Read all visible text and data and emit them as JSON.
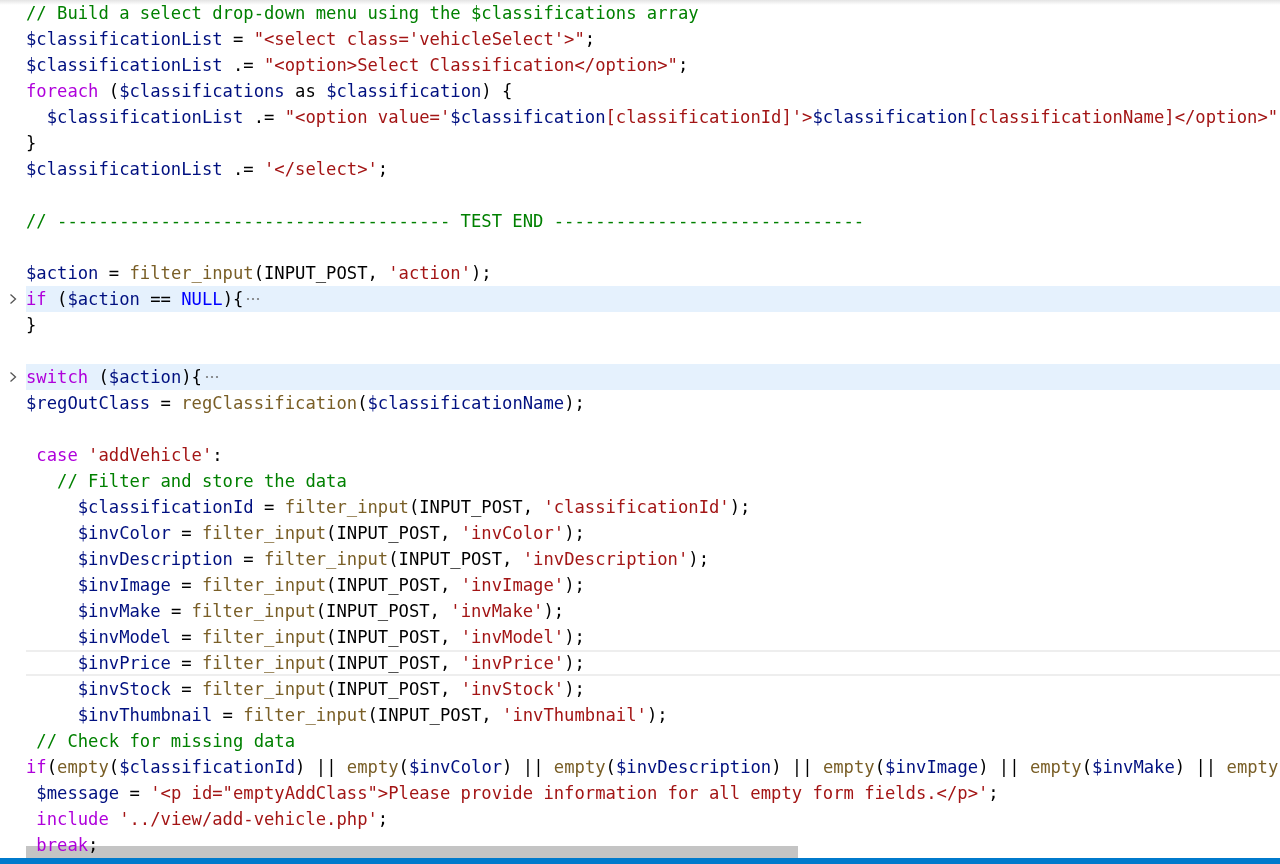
{
  "editor": {
    "lines": [
      {
        "kind": "code",
        "folded": false,
        "current": false,
        "tokens": [
          {
            "kind": "comment",
            "t": "// Build a select drop-down menu using the $classifications array"
          }
        ]
      },
      {
        "kind": "code",
        "folded": false,
        "current": false,
        "tokens": [
          {
            "kind": "var",
            "t": "$classificationList"
          },
          {
            "kind": "plain",
            "t": " = "
          },
          {
            "kind": "string",
            "t": "\"<select class='vehicleSelect'>\""
          },
          {
            "kind": "plain",
            "t": ";"
          }
        ]
      },
      {
        "kind": "code",
        "folded": false,
        "current": false,
        "tokens": [
          {
            "kind": "var",
            "t": "$classificationList"
          },
          {
            "kind": "plain",
            "t": " .= "
          },
          {
            "kind": "string",
            "t": "\"<option>Select Classification</option>\""
          },
          {
            "kind": "plain",
            "t": ";"
          }
        ]
      },
      {
        "kind": "code",
        "folded": false,
        "current": false,
        "tokens": [
          {
            "kind": "keyword",
            "t": "foreach"
          },
          {
            "kind": "plain",
            "t": " ("
          },
          {
            "kind": "var",
            "t": "$classifications"
          },
          {
            "kind": "plain",
            "t": " as "
          },
          {
            "kind": "var",
            "t": "$classification"
          },
          {
            "kind": "plain",
            "t": ") {"
          }
        ]
      },
      {
        "kind": "code",
        "folded": false,
        "current": false,
        "tokens": [
          {
            "kind": "var",
            "t": "  $classificationList"
          },
          {
            "kind": "plain",
            "t": " .= "
          },
          {
            "kind": "string",
            "t": "\"<option value='"
          },
          {
            "kind": "var",
            "t": "$classification"
          },
          {
            "kind": "string",
            "t": "[classificationId]'>"
          },
          {
            "kind": "var",
            "t": "$classification"
          },
          {
            "kind": "string",
            "t": "[classificationName]</option>\""
          }
        ]
      },
      {
        "kind": "code",
        "folded": false,
        "current": false,
        "tokens": [
          {
            "kind": "plain",
            "t": "}"
          }
        ]
      },
      {
        "kind": "code",
        "folded": false,
        "current": false,
        "tokens": [
          {
            "kind": "var",
            "t": "$classificationList"
          },
          {
            "kind": "plain",
            "t": " .= "
          },
          {
            "kind": "string",
            "t": "'</select>'"
          },
          {
            "kind": "plain",
            "t": ";"
          }
        ]
      },
      {
        "kind": "blank"
      },
      {
        "kind": "code",
        "folded": false,
        "current": false,
        "tokens": [
          {
            "kind": "comment",
            "t": "// -------------------------------------- TEST END ------------------------------"
          }
        ]
      },
      {
        "kind": "blank"
      },
      {
        "kind": "code",
        "folded": false,
        "current": false,
        "tokens": [
          {
            "kind": "var",
            "t": "$action"
          },
          {
            "kind": "plain",
            "t": " = "
          },
          {
            "kind": "func",
            "t": "filter_input"
          },
          {
            "kind": "plain",
            "t": "(INPUT_POST, "
          },
          {
            "kind": "string",
            "t": "'action'"
          },
          {
            "kind": "plain",
            "t": ");"
          }
        ]
      },
      {
        "kind": "code",
        "folded": true,
        "current": false,
        "tokens": [
          {
            "kind": "keyword",
            "t": "if"
          },
          {
            "kind": "plain",
            "t": " ("
          },
          {
            "kind": "var",
            "t": "$action"
          },
          {
            "kind": "plain",
            "t": " == "
          },
          {
            "kind": "const",
            "t": "NULL"
          },
          {
            "kind": "plain",
            "t": "){"
          }
        ]
      },
      {
        "kind": "code",
        "folded": false,
        "current": false,
        "tokens": [
          {
            "kind": "plain",
            "t": "}"
          }
        ]
      },
      {
        "kind": "blank"
      },
      {
        "kind": "code",
        "folded": true,
        "current": false,
        "tokens": [
          {
            "kind": "keyword",
            "t": "switch"
          },
          {
            "kind": "plain",
            "t": " ("
          },
          {
            "kind": "var",
            "t": "$action"
          },
          {
            "kind": "plain",
            "t": "){"
          }
        ]
      },
      {
        "kind": "code",
        "folded": false,
        "current": false,
        "tokens": [
          {
            "kind": "var",
            "t": "$regOutClass"
          },
          {
            "kind": "plain",
            "t": " = "
          },
          {
            "kind": "func",
            "t": "regClassification"
          },
          {
            "kind": "plain",
            "t": "("
          },
          {
            "kind": "var",
            "t": "$classificationName"
          },
          {
            "kind": "plain",
            "t": ");"
          }
        ]
      },
      {
        "kind": "blank"
      },
      {
        "kind": "code",
        "folded": false,
        "current": false,
        "tokens": [
          {
            "kind": "keyword",
            "t": " case"
          },
          {
            "kind": "string",
            "t": " 'addVehicle'"
          },
          {
            "kind": "plain",
            "t": ":"
          }
        ]
      },
      {
        "kind": "code",
        "folded": false,
        "current": false,
        "tokens": [
          {
            "kind": "comment",
            "t": "   // Filter and store the data"
          }
        ]
      },
      {
        "kind": "code",
        "folded": false,
        "current": false,
        "tokens": [
          {
            "kind": "var",
            "t": "     $classificationId"
          },
          {
            "kind": "plain",
            "t": " = "
          },
          {
            "kind": "func",
            "t": "filter_input"
          },
          {
            "kind": "plain",
            "t": "(INPUT_POST, "
          },
          {
            "kind": "string",
            "t": "'classificationId'"
          },
          {
            "kind": "plain",
            "t": ");"
          }
        ]
      },
      {
        "kind": "code",
        "folded": false,
        "current": false,
        "tokens": [
          {
            "kind": "var",
            "t": "     $invColor"
          },
          {
            "kind": "plain",
            "t": " = "
          },
          {
            "kind": "func",
            "t": "filter_input"
          },
          {
            "kind": "plain",
            "t": "(INPUT_POST, "
          },
          {
            "kind": "string",
            "t": "'invColor'"
          },
          {
            "kind": "plain",
            "t": ");"
          }
        ]
      },
      {
        "kind": "code",
        "folded": false,
        "current": false,
        "tokens": [
          {
            "kind": "var",
            "t": "     $invDescription"
          },
          {
            "kind": "plain",
            "t": " = "
          },
          {
            "kind": "func",
            "t": "filter_input"
          },
          {
            "kind": "plain",
            "t": "(INPUT_POST, "
          },
          {
            "kind": "string",
            "t": "'invDescription'"
          },
          {
            "kind": "plain",
            "t": ");"
          }
        ]
      },
      {
        "kind": "code",
        "folded": false,
        "current": false,
        "tokens": [
          {
            "kind": "var",
            "t": "     $invImage"
          },
          {
            "kind": "plain",
            "t": " = "
          },
          {
            "kind": "func",
            "t": "filter_input"
          },
          {
            "kind": "plain",
            "t": "(INPUT_POST, "
          },
          {
            "kind": "string",
            "t": "'invImage'"
          },
          {
            "kind": "plain",
            "t": ");"
          }
        ]
      },
      {
        "kind": "code",
        "folded": false,
        "current": false,
        "tokens": [
          {
            "kind": "var",
            "t": "     $invMake"
          },
          {
            "kind": "plain",
            "t": " = "
          },
          {
            "kind": "func",
            "t": "filter_input"
          },
          {
            "kind": "plain",
            "t": "(INPUT_POST, "
          },
          {
            "kind": "string",
            "t": "'invMake'"
          },
          {
            "kind": "plain",
            "t": ");"
          }
        ]
      },
      {
        "kind": "code",
        "folded": false,
        "current": false,
        "tokens": [
          {
            "kind": "var",
            "t": "     $invModel"
          },
          {
            "kind": "plain",
            "t": " = "
          },
          {
            "kind": "func",
            "t": "filter_input"
          },
          {
            "kind": "plain",
            "t": "(INPUT_POST, "
          },
          {
            "kind": "string",
            "t": "'invModel'"
          },
          {
            "kind": "plain",
            "t": ");"
          }
        ]
      },
      {
        "kind": "code",
        "folded": false,
        "current": true,
        "tokens": [
          {
            "kind": "var",
            "t": "     $invPrice"
          },
          {
            "kind": "plain",
            "t": " = "
          },
          {
            "kind": "func",
            "t": "filter_input"
          },
          {
            "kind": "plain",
            "t": "(INPUT_POST, "
          },
          {
            "kind": "string",
            "t": "'invPrice'"
          },
          {
            "kind": "plain",
            "t": ");"
          }
        ]
      },
      {
        "kind": "code",
        "folded": false,
        "current": false,
        "tokens": [
          {
            "kind": "var",
            "t": "     $invStock"
          },
          {
            "kind": "plain",
            "t": " = "
          },
          {
            "kind": "func",
            "t": "filter_input"
          },
          {
            "kind": "plain",
            "t": "(INPUT_POST, "
          },
          {
            "kind": "string",
            "t": "'invStock'"
          },
          {
            "kind": "plain",
            "t": ");"
          }
        ]
      },
      {
        "kind": "code",
        "folded": false,
        "current": false,
        "tokens": [
          {
            "kind": "var",
            "t": "     $invThumbnail"
          },
          {
            "kind": "plain",
            "t": " = "
          },
          {
            "kind": "func",
            "t": "filter_input"
          },
          {
            "kind": "plain",
            "t": "(INPUT_POST, "
          },
          {
            "kind": "string",
            "t": "'invThumbnail'"
          },
          {
            "kind": "plain",
            "t": ");"
          }
        ]
      },
      {
        "kind": "code",
        "folded": false,
        "current": false,
        "tokens": [
          {
            "kind": "comment",
            "t": " // Check for missing data"
          }
        ]
      },
      {
        "kind": "code",
        "folded": false,
        "current": false,
        "tokens": [
          {
            "kind": "keyword",
            "t": "if"
          },
          {
            "kind": "plain",
            "t": "("
          },
          {
            "kind": "func",
            "t": "empty"
          },
          {
            "kind": "plain",
            "t": "("
          },
          {
            "kind": "var",
            "t": "$classificationId"
          },
          {
            "kind": "plain",
            "t": ") || "
          },
          {
            "kind": "func",
            "t": "empty"
          },
          {
            "kind": "plain",
            "t": "("
          },
          {
            "kind": "var",
            "t": "$invColor"
          },
          {
            "kind": "plain",
            "t": ") || "
          },
          {
            "kind": "func",
            "t": "empty"
          },
          {
            "kind": "plain",
            "t": "("
          },
          {
            "kind": "var",
            "t": "$invDescription"
          },
          {
            "kind": "plain",
            "t": ") || "
          },
          {
            "kind": "func",
            "t": "empty"
          },
          {
            "kind": "plain",
            "t": "("
          },
          {
            "kind": "var",
            "t": "$invImage"
          },
          {
            "kind": "plain",
            "t": ") || "
          },
          {
            "kind": "func",
            "t": "empty"
          },
          {
            "kind": "plain",
            "t": "("
          },
          {
            "kind": "var",
            "t": "$invMake"
          },
          {
            "kind": "plain",
            "t": ") || "
          },
          {
            "kind": "func",
            "t": "empty"
          }
        ]
      },
      {
        "kind": "code",
        "folded": false,
        "current": false,
        "tokens": [
          {
            "kind": "var",
            "t": " $message"
          },
          {
            "kind": "plain",
            "t": " = "
          },
          {
            "kind": "string",
            "t": "'<p id=\"emptyAddClass\">Please provide information for all empty form fields.</p>'"
          },
          {
            "kind": "plain",
            "t": ";"
          }
        ]
      },
      {
        "kind": "code",
        "folded": false,
        "current": false,
        "tokens": [
          {
            "kind": "keyword",
            "t": " include"
          },
          {
            "kind": "string",
            "t": " '../view/add-vehicle.php'"
          },
          {
            "kind": "plain",
            "t": ";"
          }
        ]
      },
      {
        "kind": "code",
        "folded": false,
        "current": false,
        "tokens": [
          {
            "kind": "keyword",
            "t": " break"
          },
          {
            "kind": "plain",
            "t": ";"
          }
        ]
      }
    ]
  }
}
